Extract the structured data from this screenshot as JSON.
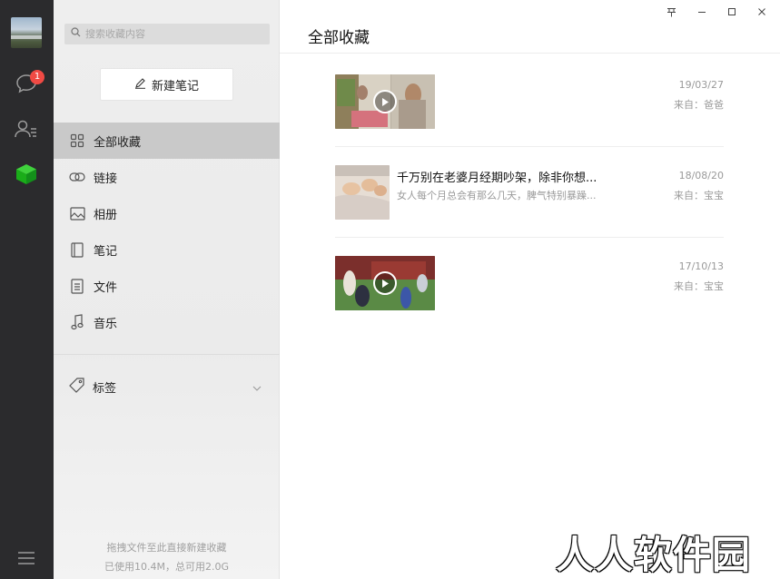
{
  "rail": {
    "icons": [
      "chat-icon",
      "contacts-icon",
      "favorites-cube-icon",
      "menu-icon"
    ],
    "unread_count": "1",
    "accent_color": "#1aad19"
  },
  "sidebar": {
    "search_placeholder": "搜索收藏内容",
    "new_note_label": "新建笔记",
    "items": [
      {
        "label": "全部收藏",
        "icon": "grid-icon",
        "active": true
      },
      {
        "label": "链接",
        "icon": "link-icon",
        "active": false
      },
      {
        "label": "相册",
        "icon": "image-icon",
        "active": false
      },
      {
        "label": "笔记",
        "icon": "note-icon",
        "active": false
      },
      {
        "label": "文件",
        "icon": "file-icon",
        "active": false
      },
      {
        "label": "音乐",
        "icon": "music-icon",
        "active": false
      }
    ],
    "tags_label": "标签",
    "footer_line1": "拖拽文件至此直接新建收藏",
    "footer_line2": "已使用10.4M，总可用2.0G"
  },
  "main": {
    "title": "全部收藏",
    "window_controls": [
      "pin-icon",
      "minimize-icon",
      "maximize-icon",
      "close-icon"
    ],
    "items": [
      {
        "type": "video",
        "date": "19/03/27",
        "source": "来自：爸爸"
      },
      {
        "type": "article",
        "title": "千万别在老婆月经期吵架，除非你想...",
        "summary": "女人每个月总会有那么几天，脾气特别暴躁...",
        "date": "18/08/20",
        "source": "来自：宝宝"
      },
      {
        "type": "video",
        "date": "17/10/13",
        "source": "来自：宝宝"
      }
    ]
  },
  "watermark": "人人软件园"
}
